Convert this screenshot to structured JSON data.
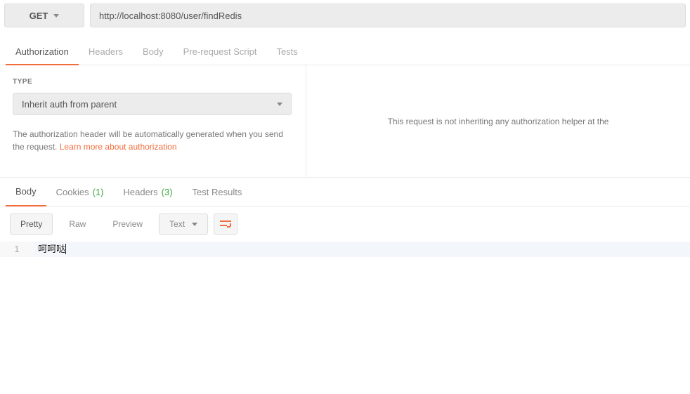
{
  "request": {
    "method": "GET",
    "url": "http://localhost:8080/user/findRedis"
  },
  "reqTabs": {
    "authorization": "Authorization",
    "headers": "Headers",
    "body": "Body",
    "prerequest": "Pre-request Script",
    "tests": "Tests"
  },
  "auth": {
    "typeLabel": "TYPE",
    "selected": "Inherit auth from parent",
    "helper_pre": "The authorization header will be automatically generated when you send the request. ",
    "helper_link": "Learn more about authorization",
    "right_msg": "This request is not inheriting any authorization helper at the"
  },
  "respTabs": {
    "body": "Body",
    "cookies": "Cookies",
    "cookies_count": "(1)",
    "headers": "Headers",
    "headers_count": "(3)",
    "tests": "Test Results"
  },
  "viewer": {
    "pretty": "Pretty",
    "raw": "Raw",
    "preview": "Preview",
    "format": "Text"
  },
  "response": {
    "line_no": "1",
    "content": "呵呵哒"
  }
}
